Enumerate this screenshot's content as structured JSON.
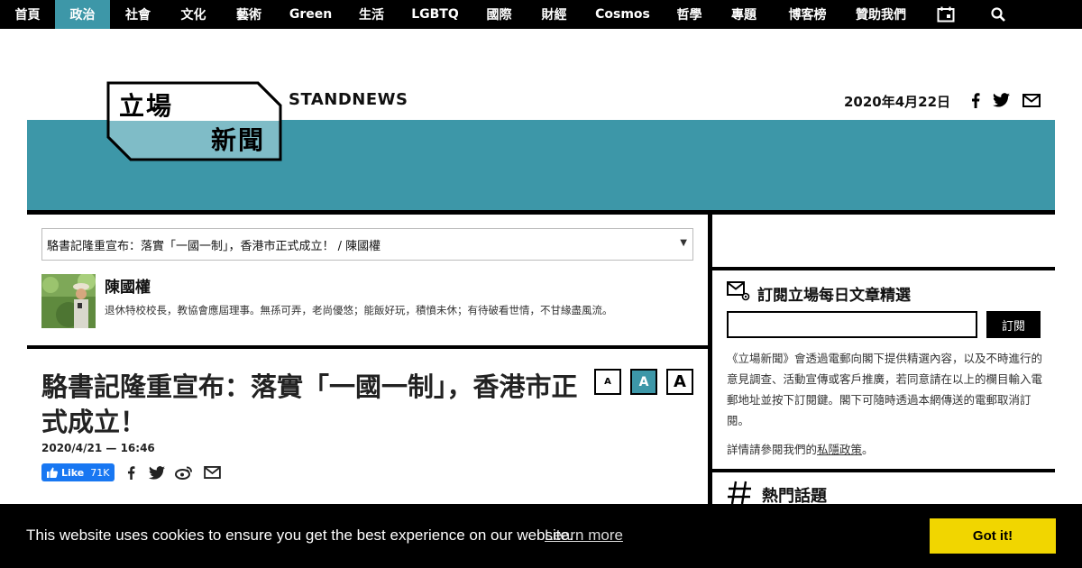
{
  "nav": {
    "items": [
      {
        "label": "首頁",
        "active": false
      },
      {
        "label": "政治",
        "active": true
      },
      {
        "label": "社會",
        "active": false
      },
      {
        "label": "文化",
        "active": false
      },
      {
        "label": "藝術",
        "active": false
      },
      {
        "label": "Green",
        "active": false
      },
      {
        "label": "生活",
        "active": false
      },
      {
        "label": "LGBTQ",
        "active": false
      },
      {
        "label": "國際",
        "active": false
      },
      {
        "label": "財經",
        "active": false
      },
      {
        "label": "Cosmos",
        "active": false
      },
      {
        "label": "哲學",
        "active": false
      },
      {
        "label": "專題",
        "active": false
      },
      {
        "label": "博客榜",
        "active": false
      },
      {
        "label": "贊助我們",
        "active": false
      }
    ],
    "icons": [
      "calendar-icon",
      "search-icon"
    ]
  },
  "header": {
    "logo_line1": "立場",
    "logo_line2": "新聞",
    "brand_en": "STANDNEWS",
    "date": "2020年4月22日",
    "share_icons": [
      "facebook-icon",
      "twitter-icon",
      "mail-icon"
    ]
  },
  "colors": {
    "accent": "#3d97a8",
    "nav_bg": "#000000",
    "cookie_bg": "#000000",
    "cookie_button": "#f1d600",
    "fb_blue": "#1877f2"
  },
  "article": {
    "selector_value": "駱書記隆重宣布：落實「一國一制」，香港市正式成立！ / 陳國權",
    "author_name": "陳國權",
    "author_bio": "退休特校校長，教協會應屆理事。無孫可弄，老尚優悠；能飯好玩，積憤未休；有待破看世情，不甘緣盡風流。",
    "title": "駱書記隆重宣布：落實「一國一制」，香港市正式成立！",
    "date": "2020/4/21 — 16:46",
    "font_buttons": [
      "A",
      "A",
      "A"
    ],
    "like_label": "Like",
    "like_count": "71K",
    "share_icons": [
      "facebook-icon",
      "twitter-icon",
      "weibo-icon",
      "mail-icon"
    ]
  },
  "sidebar": {
    "subscribe_title": "訂閱立場每日文章精選",
    "subscribe_button": "訂閱",
    "subscribe_desc": "《立場新聞》會透過電郵向閣下提供精選內容，以及不時進行的意見調查、活動宣傳或客戶推廣，若同意請在以上的欄目輸入電郵地址並按下訂閱鍵。閣下可隨時透過本網傳送的電郵取消訂閱。",
    "privacy_prefix": "詳情請參閱我們的",
    "privacy_link": "私隱政策",
    "privacy_suffix": "。",
    "hot_title": "熱門話題"
  },
  "cookie": {
    "message": "This website uses cookies to ensure you get the best experience on our website.",
    "learn_more": "Learn more",
    "button": "Got it!"
  }
}
